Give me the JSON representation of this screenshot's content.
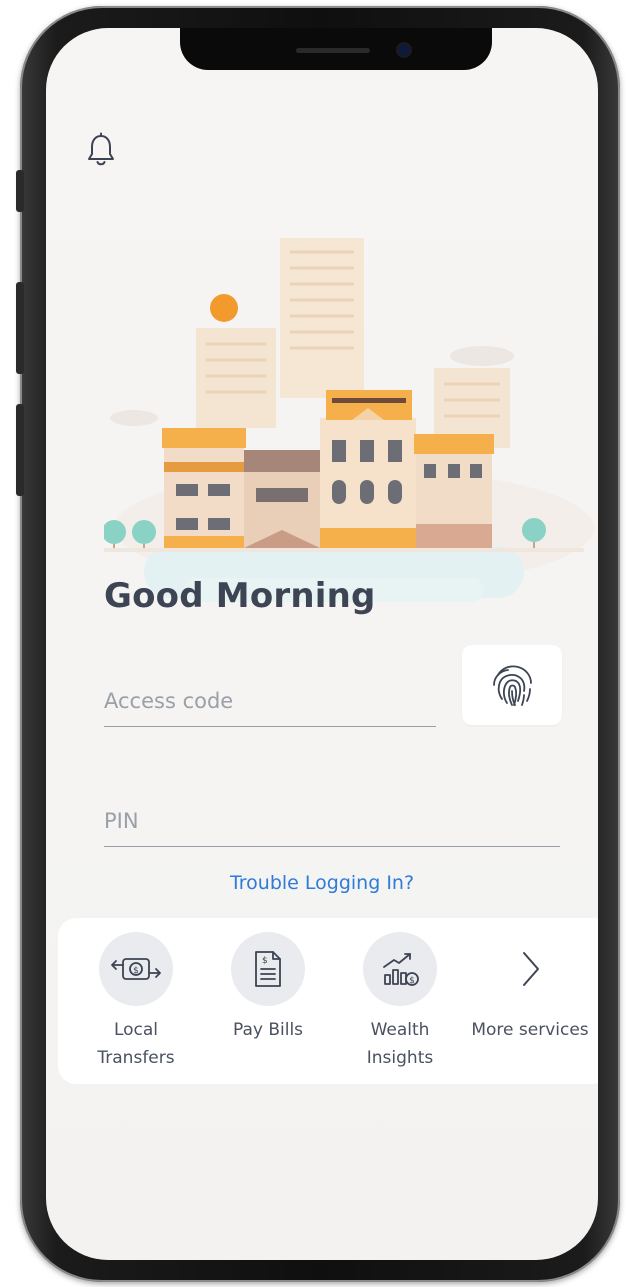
{
  "login": {
    "greeting": "Good Morning",
    "access_code_placeholder": "Access code",
    "pin_placeholder": "PIN",
    "trouble_link": "Trouble Logging In?"
  },
  "services": [
    {
      "label": "Local\nTransfers",
      "icon": "money-transfer-icon"
    },
    {
      "label": "Pay Bills",
      "icon": "bill-document-icon"
    },
    {
      "label": "Wealth\nInsights",
      "icon": "growth-chart-icon"
    },
    {
      "label": "More services",
      "icon": "chevron-right-icon"
    }
  ],
  "colors": {
    "accent_link": "#2f7bd9",
    "greeting_text": "#3d4453",
    "sun": "#f39a2c",
    "roof_orange": "#f5b04c"
  }
}
